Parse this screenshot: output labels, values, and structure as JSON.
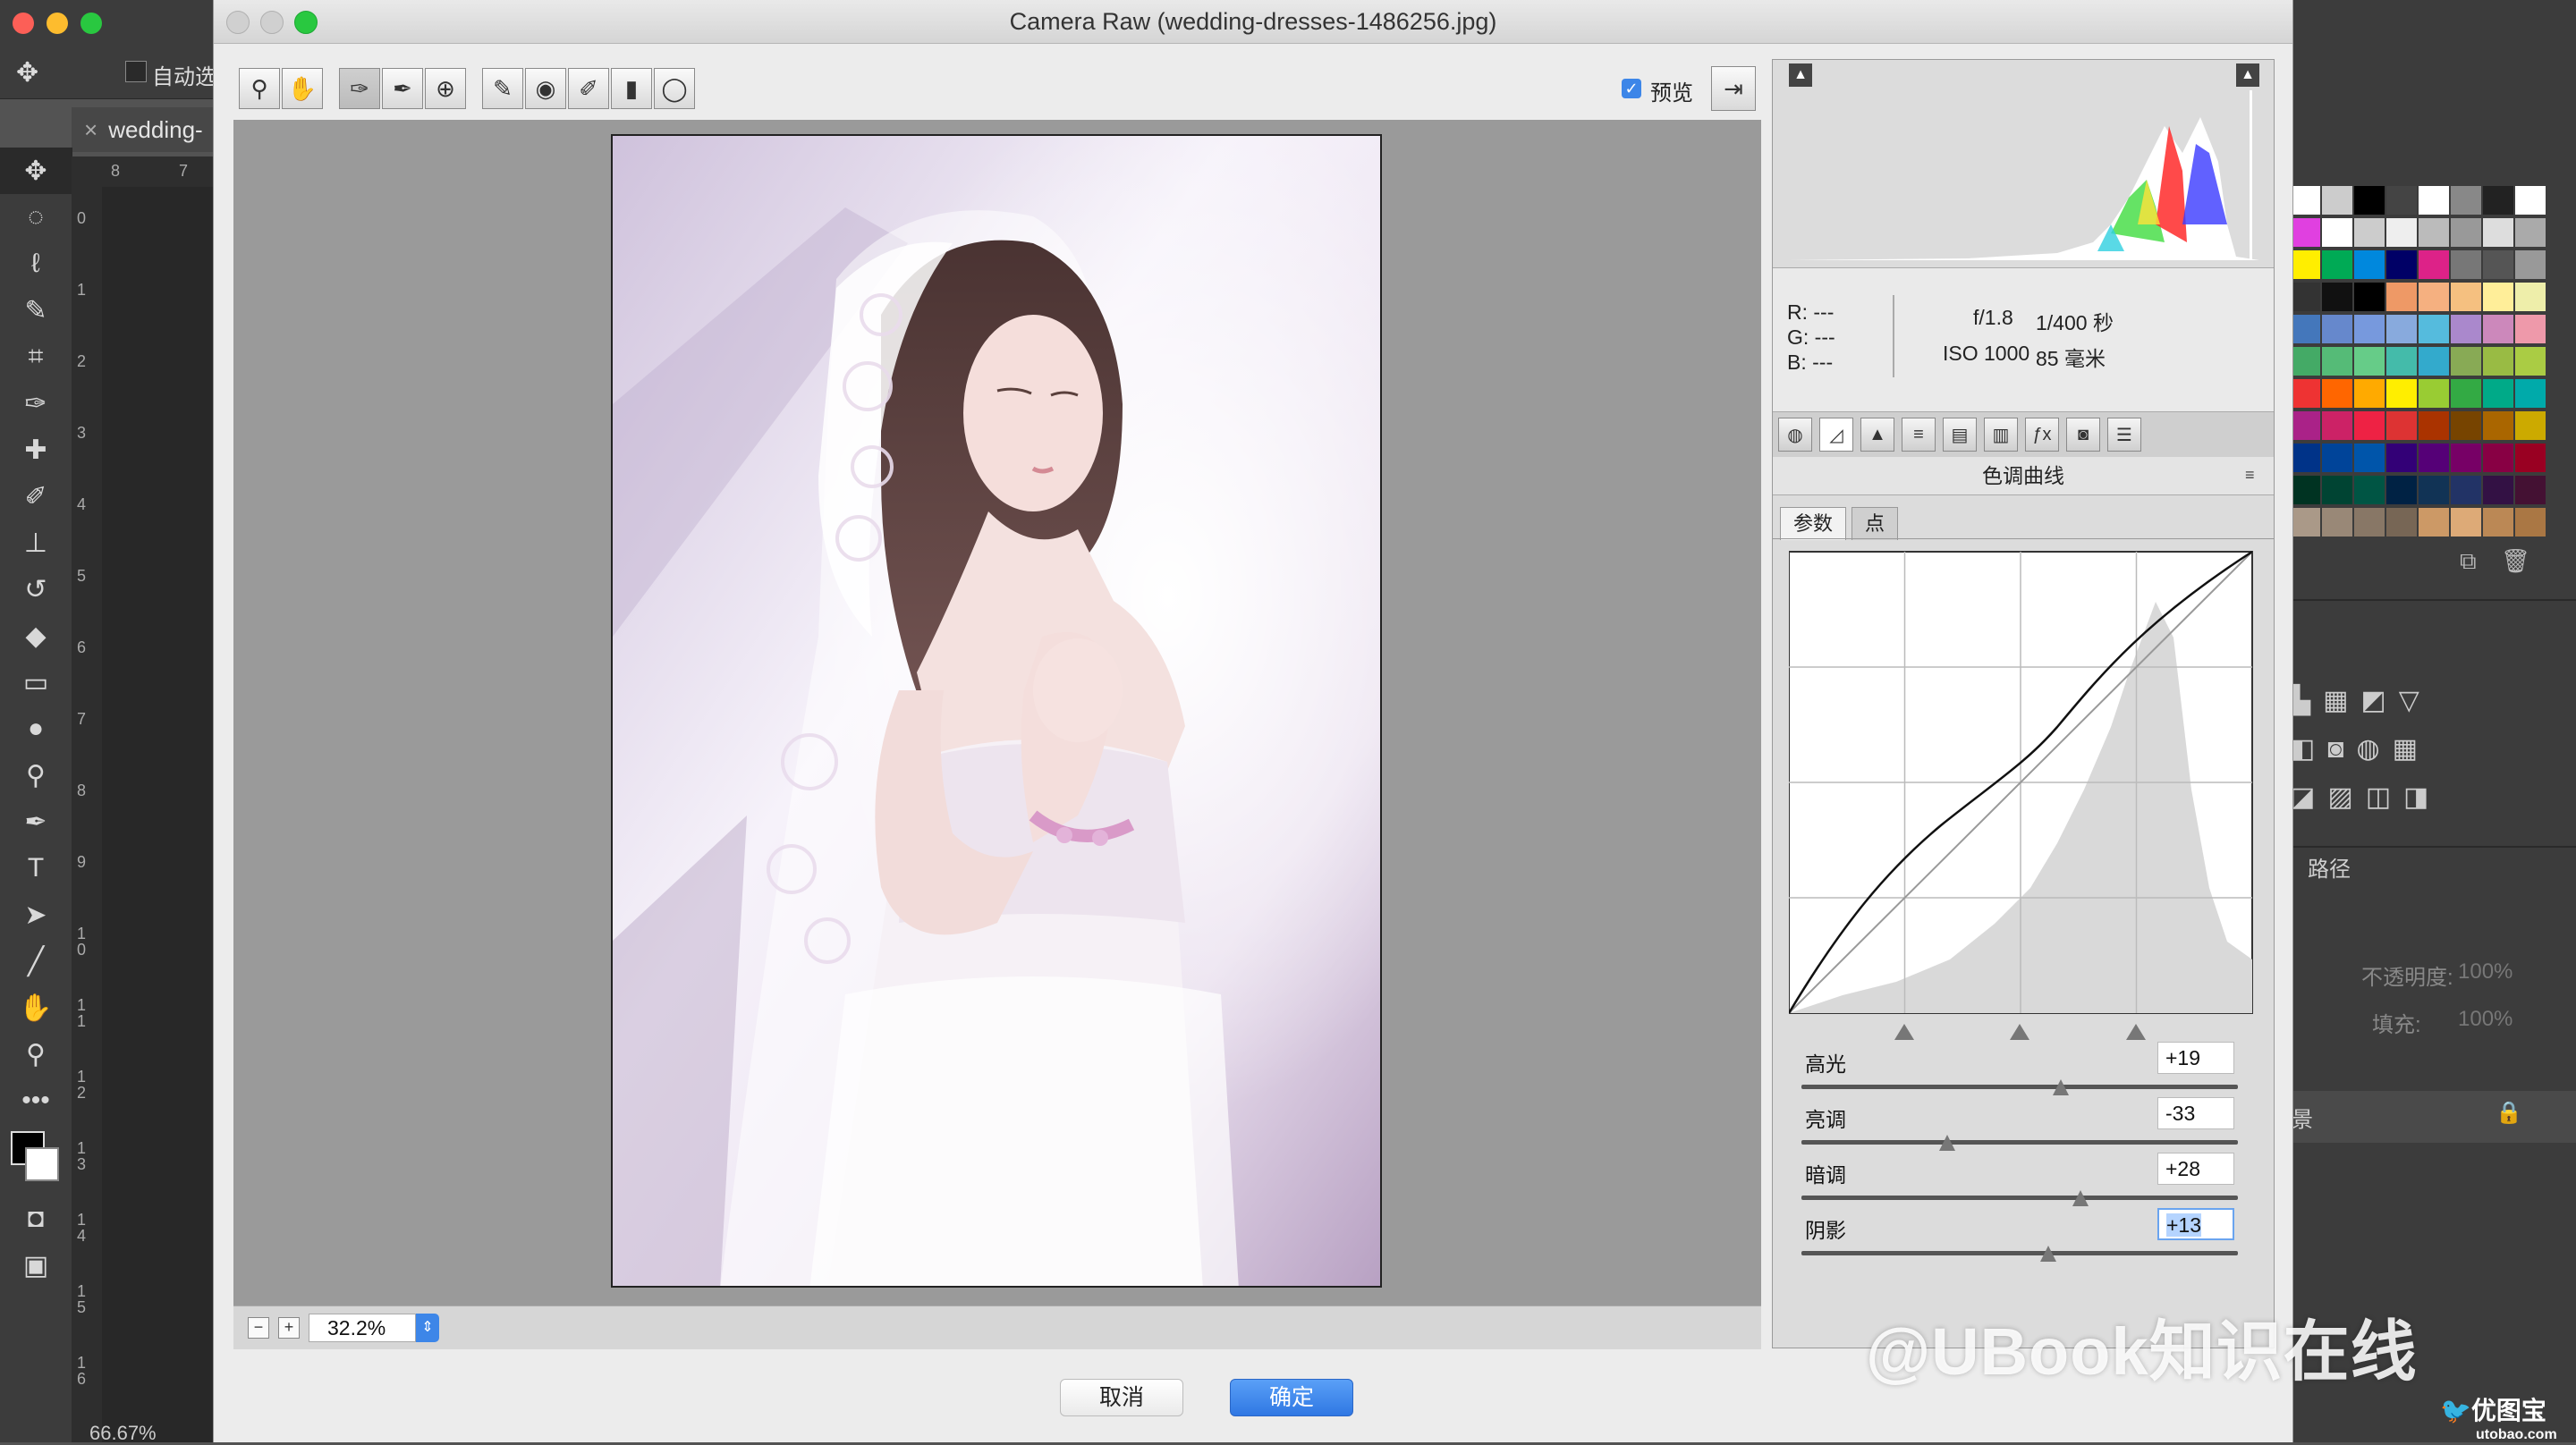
{
  "ps": {
    "auto_select_label": "自动选",
    "doc_tab": "wedding-",
    "zoom_status": "66.67%",
    "ruler_h": [
      "8",
      "7"
    ],
    "ruler_v": [
      "0",
      "1",
      "2",
      "3",
      "4",
      "5",
      "6",
      "7",
      "8",
      "9",
      "1\n0",
      "1\n1",
      "1\n2",
      "1\n3",
      "1\n4",
      "1\n5",
      "1\n6"
    ],
    "paths_label": "路径",
    "opacity_label": "不透明度:",
    "opacity_value": "100%",
    "fill_label": "填充:",
    "fill_value": "100%",
    "bg_label": "景"
  },
  "dialog": {
    "title": "Camera Raw (wedding-dresses-1486256.jpg)",
    "preview_label": "预览",
    "zoom_value": "32.2%",
    "cancel_label": "取消",
    "ok_label": "确定"
  },
  "info": {
    "r": "R:  ---",
    "g": "G:  ---",
    "b": "B:  ---",
    "aperture": "f/1.8",
    "shutter": "1/400 秒",
    "iso": "ISO 1000",
    "focal": "85 毫米"
  },
  "panel": {
    "title": "色调曲线",
    "tab_parametric": "参数",
    "tab_point": "点"
  },
  "sliders": [
    {
      "label": "高光",
      "value": "+19",
      "fraction": 0.595
    },
    {
      "label": "亮调",
      "value": "-33",
      "fraction": 0.335
    },
    {
      "label": "暗调",
      "value": "+28",
      "fraction": 0.64
    },
    {
      "label": "阴影",
      "value": "+13",
      "fraction": 0.565
    }
  ],
  "watermark": "@UBook知识在线",
  "logo": {
    "name": "优图宝",
    "url": "utobao.com"
  },
  "colors": {
    "accent": "#3d86e8",
    "dialog_bg": "#ececec",
    "canvas_bg": "#9a9a9a",
    "ps_dark": "#535353"
  },
  "icons": [
    "zoom-icon",
    "hand-icon",
    "white-balance-icon",
    "color-sampler-icon",
    "target-adjust-icon",
    "crop-icon",
    "redeye-icon",
    "brush-icon",
    "graduated-filter-icon",
    "radial-filter-icon",
    "toggle-fullscreen-icon"
  ]
}
